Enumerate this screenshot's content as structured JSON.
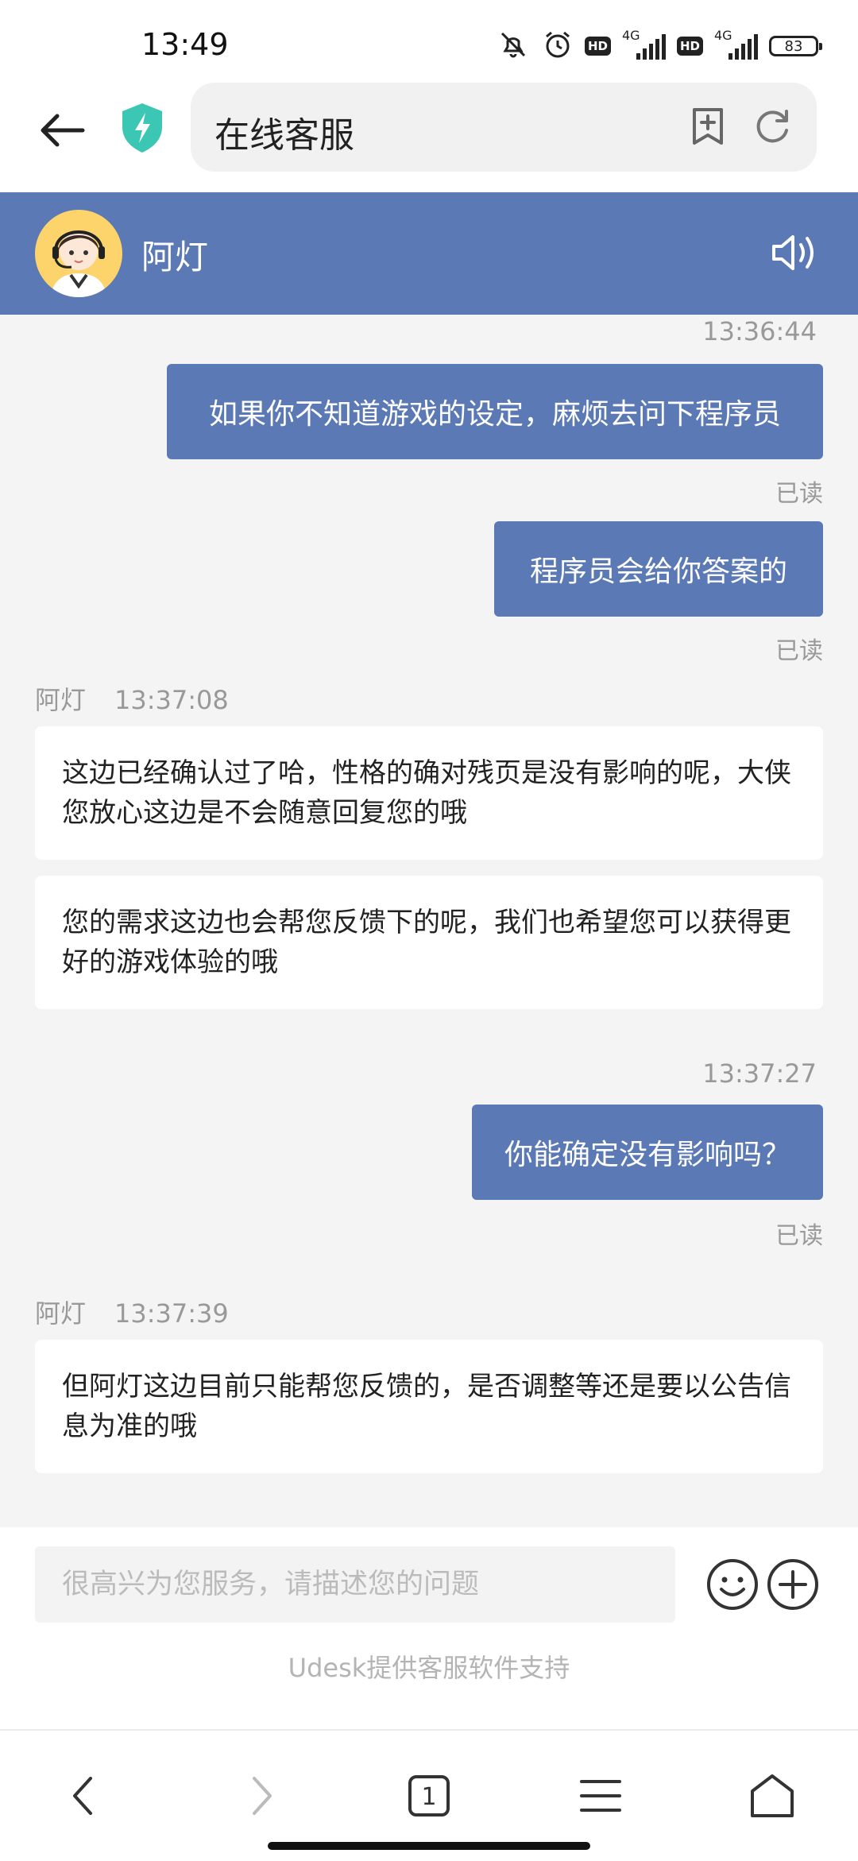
{
  "status_bar": {
    "time": "13:49",
    "battery": "83",
    "network_1": "4G",
    "network_2": "4G",
    "hd_1": "HD",
    "hd_2": "HD",
    "icons": [
      "mute-icon",
      "alarm-icon",
      "signal-icon",
      "battery-icon"
    ]
  },
  "browser": {
    "title": "在线客服",
    "icons": [
      "back-arrow-icon",
      "shield-icon",
      "bookmark-add-icon",
      "reload-icon"
    ]
  },
  "chat_header": {
    "agent_name": "阿灯",
    "bg_color": "#5b79b5",
    "icons": [
      "agent-avatar",
      "speaker-icon"
    ]
  },
  "messages": {
    "ts_1": "13:36:44",
    "out_1": "如果你不知道游戏的设定，麻烦去问下程序员",
    "read_1": "已读",
    "out_2": "程序员会给你答案的",
    "read_2": "已读",
    "in_group_1": {
      "sender": "阿灯",
      "time": "13:37:08",
      "msg_1": "这边已经确认过了哈，性格的确对残页是没有影响的呢，大侠您放心这边是不会随意回复您的哦",
      "msg_2": "您的需求这边也会帮您反馈下的呢，我们也希望您可以获得更好的游戏体验的哦"
    },
    "ts_2": "13:37:27",
    "out_3": "你能确定没有影响吗？",
    "read_3": "已读",
    "in_group_2": {
      "sender": "阿灯",
      "time": "13:37:39",
      "msg_1": "但阿灯这边目前只能帮您反馈的，是否调整等还是要以公告信息为准的哦"
    }
  },
  "input": {
    "placeholder": "很高兴为您服务，请描述您的问题",
    "value": "",
    "powered_by": "Udesk提供客服软件支持",
    "icons": [
      "emoji-icon",
      "plus-icon"
    ]
  },
  "bottom_nav": {
    "tab_count": "1",
    "icons": [
      "back-icon",
      "forward-icon",
      "tabs-icon",
      "menu-icon",
      "home-icon"
    ]
  }
}
